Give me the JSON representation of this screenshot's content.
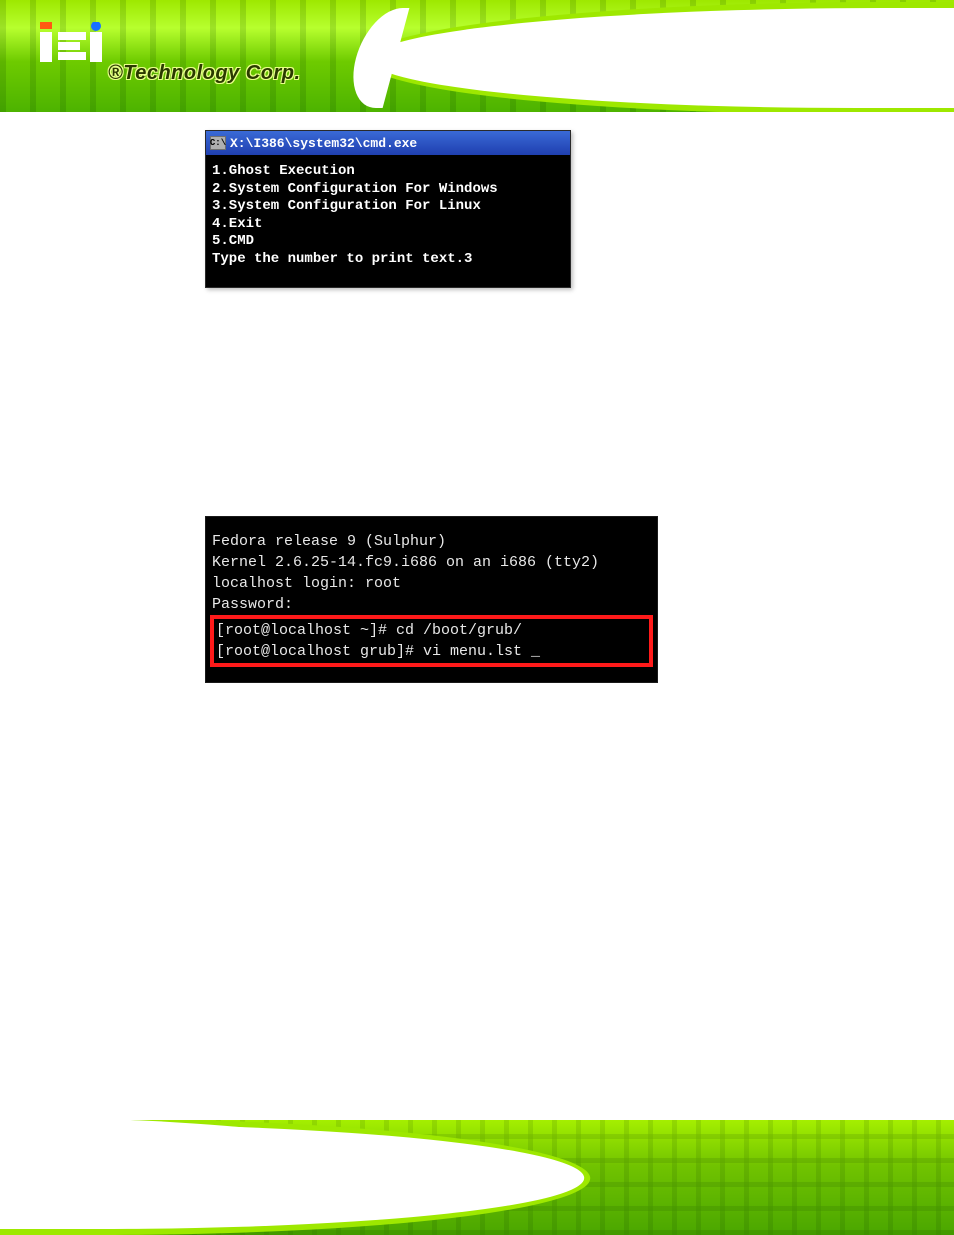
{
  "brand": {
    "logo_text": "iEi",
    "tagline": "®Technology Corp."
  },
  "screenshot_cmd": {
    "titlebar_icon_text": "C:\\",
    "title": "X:\\I386\\system32\\cmd.exe",
    "lines": {
      "l1": "1.Ghost Execution",
      "l2": "2.System Configuration For Windows",
      "l3": "3.System Configuration For Linux",
      "l4": "4.Exit",
      "l5": "5.CMD",
      "l6": "Type the number to print text.3"
    }
  },
  "screenshot_linux": {
    "l1": "Fedora release 9 (Sulphur)",
    "l2": "Kernel 2.6.25-14.fc9.i686 on an i686 (tty2)",
    "blank": " ",
    "l3": "localhost login: root",
    "l4": "Password:",
    "hl1": "[root@localhost ~]# cd /boot/grub/",
    "hl2": "[root@localhost grub]# vi menu.lst _"
  }
}
